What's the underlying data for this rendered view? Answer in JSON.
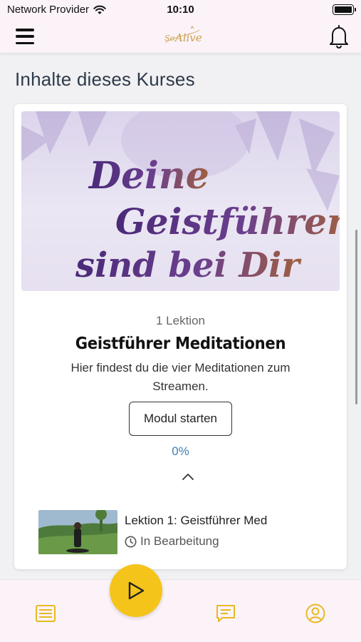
{
  "status_bar": {
    "carrier": "Network Provider",
    "time": "10:10"
  },
  "header": {
    "menu_icon": "hamburger-menu-icon",
    "logo_text": "So Alive",
    "notification_icon": "bell-icon"
  },
  "main": {
    "section_title": "Inhalte dieses Kurses",
    "module": {
      "banner_text": [
        "Deine",
        "Geistführer",
        "sind bei Dir"
      ],
      "lesson_count": "1  Lektion",
      "title": "Geistführer Meditationen",
      "description": "Hier findest du die vier Meditationen zum Streamen.",
      "start_button": "Modul starten",
      "progress": "0%",
      "progress_fraction": 0,
      "lessons": [
        {
          "title": "Lektion 1: Geistführer Med",
          "status": "In Bearbeitung",
          "status_icon": "clock-icon"
        }
      ]
    }
  },
  "bottom_nav": {
    "items": [
      {
        "icon": "course-list-icon"
      },
      {
        "icon": "play-icon"
      },
      {
        "icon": "chat-icon"
      },
      {
        "icon": "user-profile-icon"
      }
    ]
  },
  "colors": {
    "accent": "#f5c41a",
    "header_bg": "#fbf3f8",
    "progress_text": "#3f7fb6",
    "banner_text": "#5a2f82"
  }
}
